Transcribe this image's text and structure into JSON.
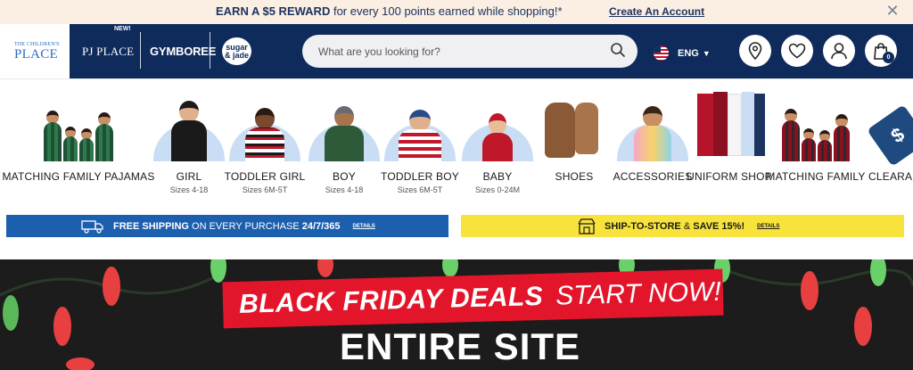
{
  "promo": {
    "headline": "EARN A $5 REWARD",
    "text": " for every 100 points earned while shopping!*",
    "link": "Create An Account",
    "close_icon": "close-icon"
  },
  "header": {
    "logo_small": "THE CHILDREN'S",
    "logo_big": "PLACE",
    "brand_new": "NEW!",
    "brand_pj": "PJ PLACE",
    "brand_gym": "GYMBOREE",
    "brand_sj": "sugar & jade",
    "search_placeholder": "What are you looking for?",
    "language": "ENG",
    "bag_count": "0"
  },
  "categories": [
    {
      "label": "MATCHING FAMILY PAJAMAS",
      "sub": ""
    },
    {
      "label": "GIRL",
      "sub": "Sizes 4-18"
    },
    {
      "label": "TODDLER GIRL",
      "sub": "Sizes 6M-5T"
    },
    {
      "label": "BOY",
      "sub": "Sizes 4-18"
    },
    {
      "label": "TODDLER BOY",
      "sub": "Sizes 6M-5T"
    },
    {
      "label": "BABY",
      "sub": "Sizes 0-24M"
    },
    {
      "label": "SHOES",
      "sub": ""
    },
    {
      "label": "ACCESSORIES",
      "sub": ""
    },
    {
      "label": "UNIFORM SHOP",
      "sub": ""
    },
    {
      "label": "MATCHING FAMILY",
      "sub": ""
    },
    {
      "label": "CLEARANCE",
      "sub": ""
    }
  ],
  "shipping": {
    "free_bold": "FREE SHIPPING",
    "free_text": " ON EVERY PURCHASE ",
    "free_bold2": "24/7/365",
    "details": "DETAILS",
    "store_bold": "SHIP-TO-STORE",
    "store_text": " & ",
    "store_bold2": "SAVE 15%!"
  },
  "hero": {
    "title": "BLACK FRIDAY DEALS",
    "subtitle": "START NOW!",
    "entire": "ENTIRE SITE"
  },
  "colors": {
    "navy": "#0e2b5c",
    "promo_bg": "#fbeee2",
    "ship_blue": "#1b5fae",
    "ship_yellow": "#f7e33c",
    "bf_red": "#e3152b"
  }
}
